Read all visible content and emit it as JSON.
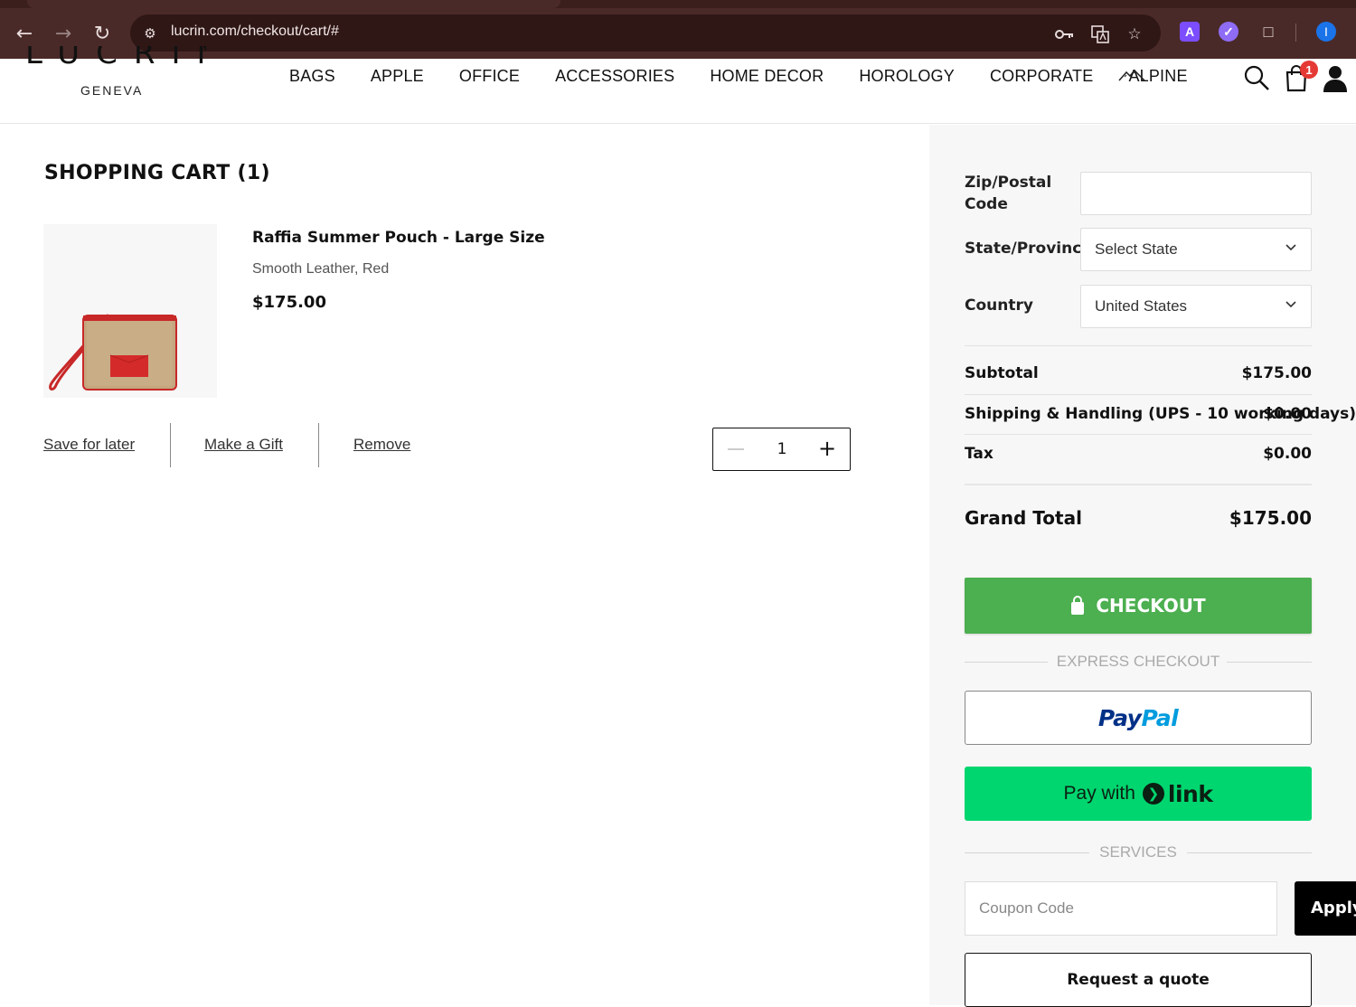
{
  "browser": {
    "url": "lucrin.com/checkout/cart/#",
    "back_icon": "arrow-left-icon",
    "forward_icon": "arrow-right-icon",
    "reload_icon": "reload-icon",
    "profile_initial": "I",
    "extension_a_label": "A",
    "colors": {
      "frame": "#4a2a28",
      "urlbar": "#2f1716",
      "profile": "#1a73e8"
    }
  },
  "site": {
    "logo_text": "LUCRIN",
    "logo_sub": "GENEVA",
    "nav": [
      "BAGS",
      "APPLE",
      "OFFICE",
      "ACCESSORIES",
      "HOME DECOR",
      "HOROLOGY",
      "CORPORATE",
      "ALPINE"
    ],
    "cart_count": "1"
  },
  "cart": {
    "title": "SHOPPING CART (1)",
    "item": {
      "name": "Raffia Summer Pouch - Large Size",
      "variant": "Smooth Leather, Red",
      "price": "$175.00",
      "quantity": "1"
    },
    "actions": {
      "save": "Save for later",
      "gift": "Make a Gift",
      "remove": "Remove"
    }
  },
  "summary": {
    "zip_label": "Zip/Postal Code",
    "state_label": "State/Province",
    "state_value": "Select State",
    "country_label": "Country",
    "country_value": "United States",
    "subtotal_label": "Subtotal",
    "subtotal_value": "$175.00",
    "shipping_label": "Shipping & Handling (UPS - 10 working days)",
    "shipping_value": "$0.00",
    "tax_label": "Tax",
    "tax_value": "$0.00",
    "grand_label": "Grand Total",
    "grand_value": "$175.00",
    "checkout_label": "CHECKOUT",
    "express_label": "EXPRESS CHECKOUT",
    "paypal_pay": "Pay",
    "paypal_pal": "Pal",
    "link_pay_with": "Pay with",
    "link_word": "link",
    "services_label": "SERVICES",
    "coupon_placeholder": "Coupon Code",
    "apply_label": "Apply",
    "quote_label": "Request a quote",
    "colors": {
      "checkout": "#4caf50",
      "link": "#00d66f",
      "paypal_dark": "#003087",
      "paypal_light": "#009cde",
      "badge": "#e53935"
    }
  }
}
